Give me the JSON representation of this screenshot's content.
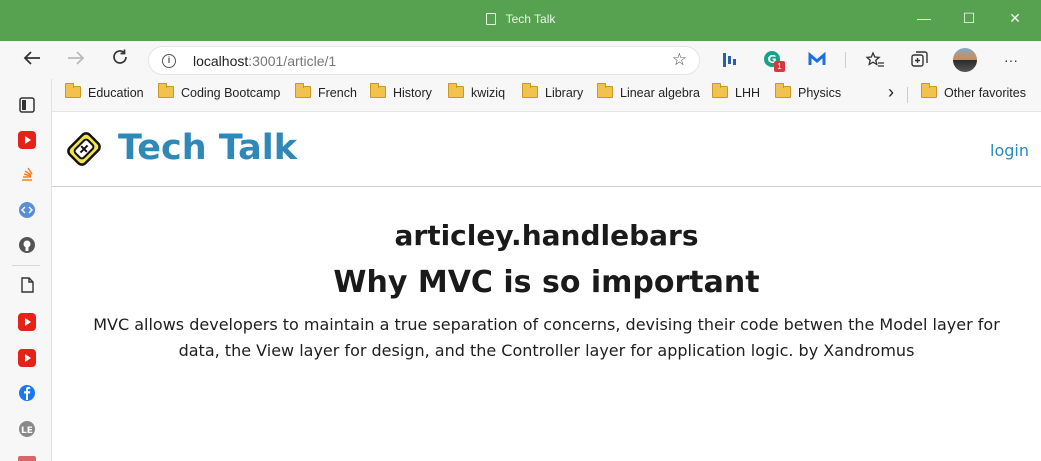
{
  "window": {
    "title": "Tech Talk",
    "controls": {
      "minimize": "—",
      "maximize": "☐",
      "close": "✕"
    }
  },
  "toolbar": {
    "url_host": "localhost",
    "url_rest": ":3001/article/1",
    "extension_badge": "1",
    "more": "···"
  },
  "bookmarks": {
    "items": [
      "Education",
      "Coding Bootcamp",
      "French",
      "History",
      "kwiziq",
      "Library",
      "Linear algebra",
      "LHH",
      "Physics"
    ],
    "overflow": "›",
    "other": "Other favorites"
  },
  "site": {
    "brand": "Tech Talk",
    "login": "login"
  },
  "article": {
    "file_heading": "articley.handlebars",
    "title": "Why MVC is so important",
    "body": "MVC allows developers to maintain a true separation of concerns, devising their code betwen the Model layer for data, the View layer for design, and the Controller layer for application logic. by Xandromus"
  },
  "colors": {
    "titlebar": "#57a250",
    "brand": "#2e88b8"
  }
}
